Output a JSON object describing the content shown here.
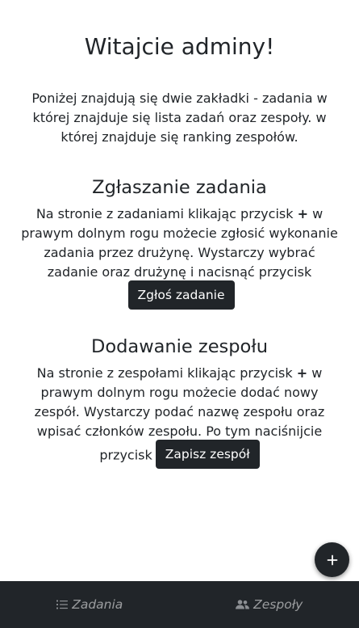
{
  "welcome": {
    "title": "Witajcie adminy!",
    "intro": "Poniżej znajdują się dwie zakładki - zadania w której znajduje się lista zadań oraz zespoły. w której znajduje się ranking zespołów."
  },
  "sections": [
    {
      "title": "Zgłaszanie zadania",
      "text_before": "Na stronie z zadaniami klikając przycisk",
      "plus": "+",
      "text_after": "w prawym dolnym rogu możecie zgłosić wykonanie zadania przez drużynę. Wystarczy wybrać zadanie oraz drużynę i nacisnąć przycisk",
      "button_label": "Zgłoś zadanie"
    },
    {
      "title": "Dodawanie zespołu",
      "text_before": "Na stronie z zespołami klikając przycisk",
      "plus": "+",
      "text_after": "w prawym dolnym rogu możecie dodać nowy zespół. Wystarczy podać nazwę zespołu oraz wpisać członków zespołu. Po tym naciśnijcie przycisk",
      "button_label": "Zapisz zespół"
    }
  ],
  "fab": {
    "icon": "plus-icon"
  },
  "bottom_nav": {
    "items": [
      {
        "label": "Zadania",
        "icon": "list-icon"
      },
      {
        "label": "Zespoły",
        "icon": "users-icon"
      }
    ]
  },
  "colors": {
    "dark": "#212529",
    "nav_text": "#8c8f93",
    "background": "#ffffff"
  }
}
